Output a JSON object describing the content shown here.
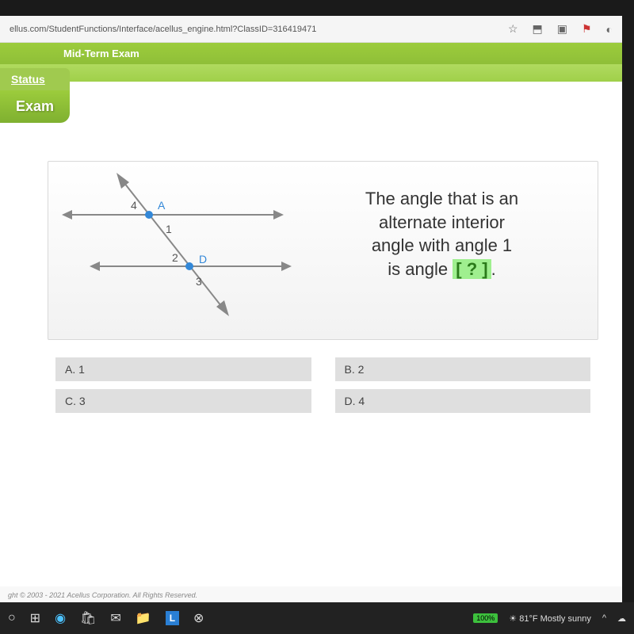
{
  "browser": {
    "url": "ellus.com/StudentFunctions/Interface/acellus_engine.html?ClassID=316419471"
  },
  "header": {
    "title": "Mid-Term Exam"
  },
  "sidebar": {
    "status_label": "Status",
    "exam_label": "Exam"
  },
  "question": {
    "line1": "The angle that is an",
    "line2": "alternate interior",
    "line3": "angle with angle 1",
    "line4_pre": "is angle ",
    "blank": "[ ? ]",
    "line4_post": "."
  },
  "diagram": {
    "point_a": "A",
    "point_d": "D",
    "angle_1": "1",
    "angle_2": "2",
    "angle_3": "3",
    "angle_4": "4"
  },
  "answers": {
    "a": "A.  1",
    "b": "B.  2",
    "c": "C.  3",
    "d": "D.  4"
  },
  "footer": {
    "copyright": "ght © 2003 - 2021 Acellus Corporation.  All Rights Reserved."
  },
  "taskbar": {
    "battery": "100%",
    "weather": "81°F  Mostly sunny"
  },
  "chart_data": {
    "type": "diagram",
    "description": "Two parallel horizontal lines cut by a transversal",
    "points": [
      {
        "name": "A",
        "on": "upper line ∩ transversal"
      },
      {
        "name": "D",
        "on": "lower line ∩ transversal"
      }
    ],
    "angles": [
      {
        "label": "4",
        "vertex": "A",
        "position": "upper-left of A"
      },
      {
        "label": "1",
        "vertex": "A",
        "position": "lower-right of A (interior)"
      },
      {
        "label": "2",
        "vertex": "D",
        "position": "upper-left of D (interior)"
      },
      {
        "label": "3",
        "vertex": "D",
        "position": "lower-right of D"
      }
    ]
  }
}
